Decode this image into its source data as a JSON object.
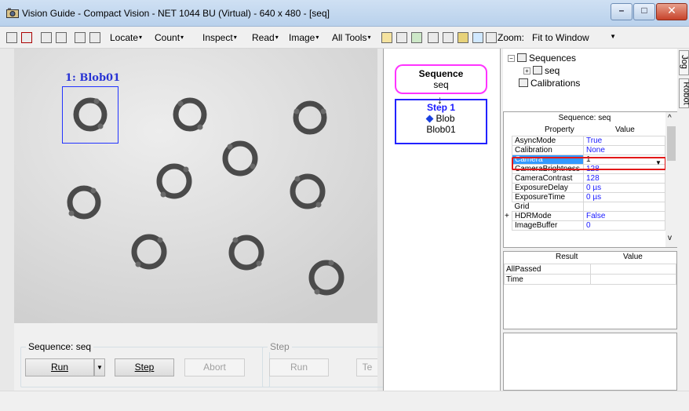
{
  "window": {
    "title": "Vision Guide - Compact Vision - NET 1044 BU (Virtual) - 640 x 480 - [seq]",
    "min_glyph": "–",
    "max_glyph": "□",
    "close_glyph": "✕"
  },
  "toolbar": {
    "menus": [
      "Locate",
      "Count",
      "Inspect",
      "Read",
      "Image",
      "All Tools"
    ],
    "zoom_label": "Zoom:",
    "zoom_value": "Fit to Window",
    "dropdown_glyph": "▾",
    "select_arrow": "▼"
  },
  "image": {
    "blob_label": "1: Blob01"
  },
  "sequence_controls": {
    "group_label": "Sequence: seq",
    "run": "Run",
    "step": "Step",
    "abort": "Abort"
  },
  "step_controls": {
    "group_label": "Step",
    "run": "Run",
    "teach": "Te"
  },
  "flow": {
    "arrow": "↓",
    "sequence_title": "Sequence",
    "sequence_name": "seq",
    "step_title": "Step 1",
    "step_type": "Blob",
    "step_name": "Blob01"
  },
  "tree": {
    "expander_open": "−",
    "expander_closed": "+",
    "sequences": "Sequences",
    "seq": "seq",
    "calibrations": "Calibrations"
  },
  "side_tabs": [
    "Jog",
    "Robot"
  ],
  "properties": {
    "header": "Sequence: seq",
    "col_property": "Property",
    "col_value": "Value",
    "scroll_up": "^",
    "scroll_down": "v",
    "grid_expander": "+",
    "rows": [
      {
        "name": "AsyncMode",
        "value": "True"
      },
      {
        "name": "Calibration",
        "value": "None"
      },
      {
        "name": "Camera",
        "value": "1"
      },
      {
        "name": "CameraBrightness",
        "value": "128"
      },
      {
        "name": "CameraContrast",
        "value": "128"
      },
      {
        "name": "ExposureDelay",
        "value": "0 µs"
      },
      {
        "name": "ExposureTime",
        "value": "0 µs"
      },
      {
        "name": "Grid",
        "value": ""
      },
      {
        "name": "HDRMode",
        "value": "False"
      },
      {
        "name": "ImageBuffer",
        "value": "0"
      }
    ]
  },
  "results": {
    "col_result": "Result",
    "col_value": "Value",
    "rows": [
      {
        "name": "AllPassed",
        "value": ""
      },
      {
        "name": "Time",
        "value": ""
      }
    ]
  }
}
